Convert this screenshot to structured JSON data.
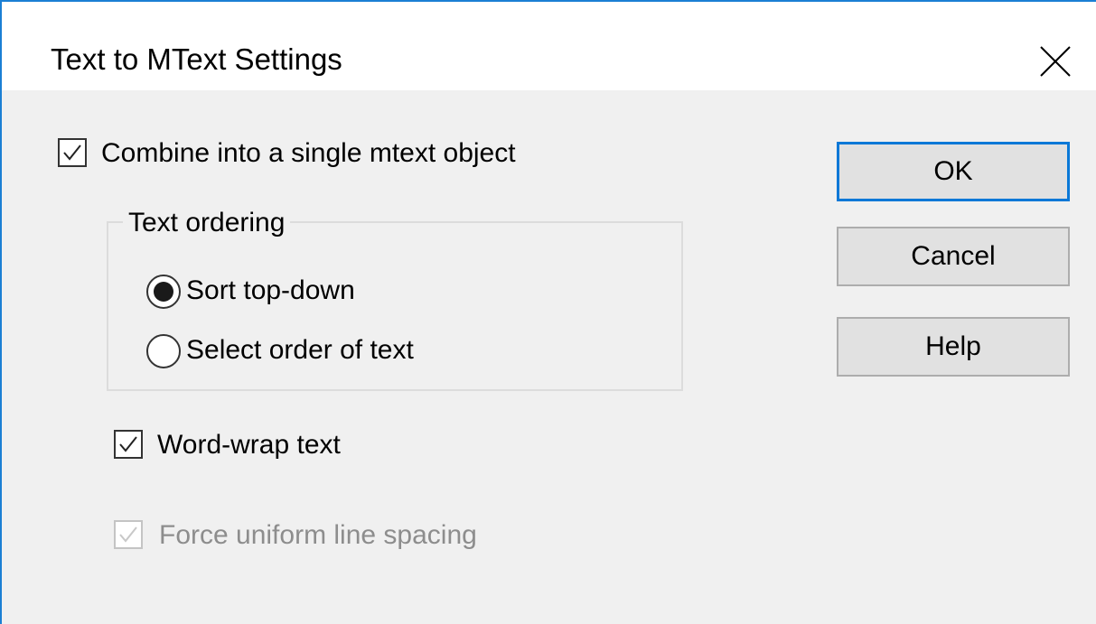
{
  "window": {
    "title": "Text to MText Settings"
  },
  "options": {
    "combine": {
      "label": "Combine into a single mtext object",
      "checked": true
    },
    "text_ordering": {
      "group_label": "Text ordering",
      "radios": [
        {
          "label": "Sort top-down",
          "selected": true
        },
        {
          "label": "Select order of text",
          "selected": false
        }
      ]
    },
    "word_wrap": {
      "label": "Word-wrap text",
      "checked": true
    },
    "force_uniform": {
      "label": "Force uniform line spacing",
      "checked": true,
      "enabled": false
    }
  },
  "buttons": {
    "ok": "OK",
    "cancel": "Cancel",
    "help": "Help"
  },
  "colors": {
    "accent": "#0a78d7",
    "window_border": "#1b7fd4",
    "dialog_bg": "#f0f0f0",
    "button_bg": "#e1e1e1",
    "disabled_text": "#8d8d8d"
  },
  "icons": {
    "close": "close-icon",
    "check": "checkmark-icon"
  }
}
